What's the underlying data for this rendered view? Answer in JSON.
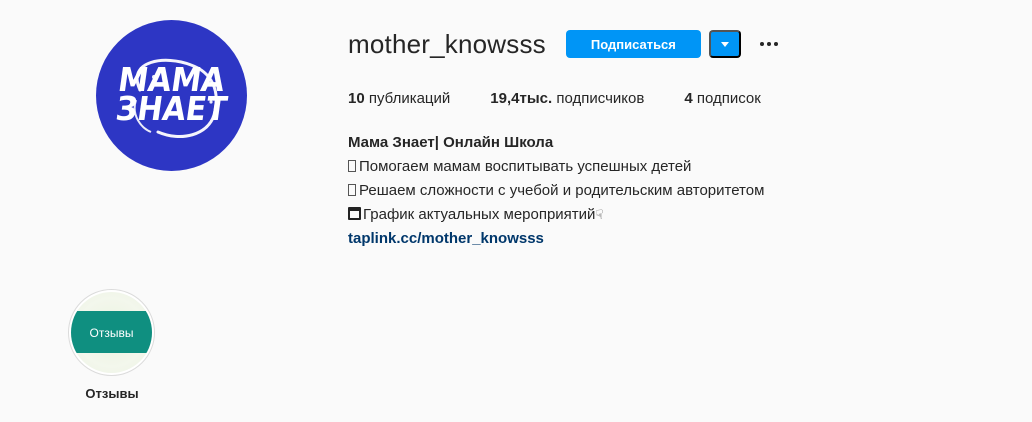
{
  "profile": {
    "username": "mother_knowsss",
    "follow_label": "Подписаться",
    "avatar_logo": {
      "line1": "МАМА",
      "line2": "ЗНАЕТ"
    },
    "stats": {
      "posts_count": "10",
      "posts_label": "публикаций",
      "followers_count": "19,4тыс.",
      "followers_label": "подписчиков",
      "following_count": "4",
      "following_label": "подписок"
    },
    "bio": {
      "name": "Мама Знает| Онлайн Школа",
      "line1": "Помогаем мамам воспитывать успешных детей",
      "line2": "Решаем сложности с учебой и родительским авторитетом",
      "line3": "График актуальных мероприятий",
      "link": "taplink.cc/mother_knowsss"
    }
  },
  "highlights": [
    {
      "cover_text": "Отзывы",
      "label": "Отзывы"
    }
  ],
  "colors": {
    "accent": "#0095f6",
    "avatar_bg": "#2d36c4",
    "highlight_band": "#0f8f80",
    "link": "#00376b"
  }
}
